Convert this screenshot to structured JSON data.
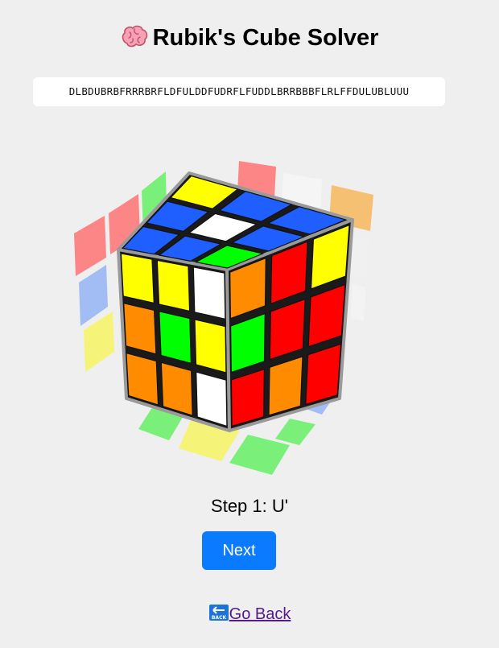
{
  "header": {
    "title": "Rubik's Cube Solver",
    "icon": "brain-icon"
  },
  "cube_state": {
    "value": "DLBDUBRBFRRRBRFLDFULDDFUDRFLFUDDLBRRBBBFLRLFFDULUBLUUU"
  },
  "cube_view": {
    "top_face": [
      "yellow",
      "blue",
      "blue",
      "blue",
      "white",
      "blue",
      "blue",
      "blue",
      "green"
    ],
    "front_face": [
      "yellow",
      "yellow",
      "white",
      "orange",
      "green",
      "yellow",
      "orange",
      "orange",
      "white"
    ],
    "right_face": [
      "orange",
      "red",
      "yellow",
      "green",
      "red",
      "red",
      "red",
      "orange",
      "red"
    ]
  },
  "colors": {
    "white": "#ffffff",
    "yellow": "#ffff00",
    "red": "#ff0000",
    "orange": "#ff8c00",
    "blue": "#1f5eff",
    "green": "#00ff00",
    "background": "#efefef",
    "button": "#0a7bff",
    "link": "#551a8b"
  },
  "step": {
    "text": "Step 1: U'"
  },
  "controls": {
    "next_label": "Next",
    "back_label": "Go Back",
    "back_icon": "back-arrow-icon"
  }
}
